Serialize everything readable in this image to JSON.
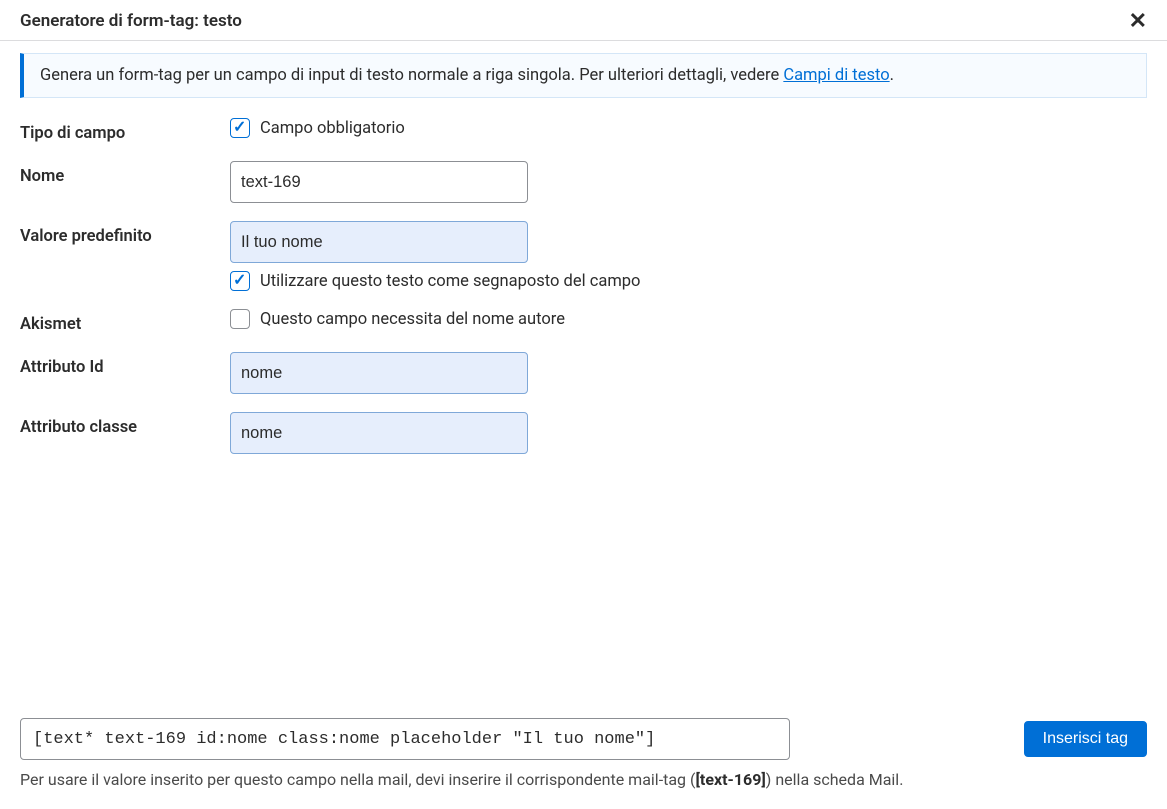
{
  "header": {
    "title": "Generatore di form-tag: testo"
  },
  "info": {
    "text_pre": "Genera un form-tag per un campo di input di testo normale a riga singola. Per ulteriori dettagli, vedere ",
    "link_text": "Campi di testo",
    "text_post": "."
  },
  "fields": {
    "type": {
      "label": "Tipo di campo",
      "checkbox_label": "Campo obbligatorio",
      "checked": true
    },
    "name": {
      "label": "Nome",
      "value": "text-169"
    },
    "default_value": {
      "label": "Valore predefinito",
      "value": "Il tuo nome",
      "placeholder_checkbox_label": "Utilizzare questo testo come segnaposto del campo",
      "placeholder_checked": true
    },
    "akismet": {
      "label": "Akismet",
      "checkbox_label": "Questo campo necessita del nome autore",
      "checked": false
    },
    "id_attr": {
      "label": "Attributo Id",
      "value": "nome"
    },
    "class_attr": {
      "label": "Attributo classe",
      "value": "nome"
    }
  },
  "footer": {
    "tag_output": "[text* text-169 id:nome class:nome placeholder \"Il tuo nome\"]",
    "insert_button": "Inserisci tag",
    "hint_pre": "Per usare il valore inserito per questo campo nella mail, devi inserire il corrispondente mail-tag (",
    "hint_tag": "[text-169]",
    "hint_post": ") nella scheda Mail."
  }
}
